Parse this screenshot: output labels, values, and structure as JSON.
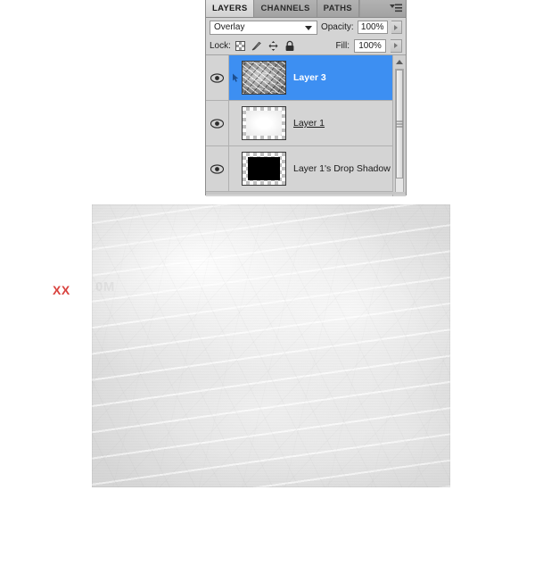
{
  "panel": {
    "tabs": [
      {
        "label": "LAYERS",
        "active": true
      },
      {
        "label": "CHANNELS",
        "active": false
      },
      {
        "label": "PATHS",
        "active": false
      }
    ],
    "menu_icon": "panel-menu-icon",
    "blend_mode": {
      "value": "Overlay",
      "caret_icon": "chevron-down-icon"
    },
    "opacity": {
      "label": "Opacity:",
      "value": "100%",
      "stepper_icon": "chevron-right-icon"
    },
    "fill": {
      "label": "Fill:",
      "value": "100%",
      "stepper_icon": "chevron-right-icon"
    },
    "lock": {
      "label": "Lock:",
      "icons": [
        {
          "name": "lock-transparent-pixels-icon"
        },
        {
          "name": "lock-image-pixels-brush-icon"
        },
        {
          "name": "lock-position-move-icon"
        },
        {
          "name": "lock-all-padlock-icon"
        }
      ]
    },
    "layers": [
      {
        "name": "Layer 3",
        "visible": true,
        "selected": true,
        "underlined": false,
        "thumbnail": "crumpled-grayscale-thumbnail",
        "has_link_marker": true
      },
      {
        "name": "Layer 1",
        "visible": true,
        "selected": false,
        "underlined": true,
        "thumbnail": "white-glow-transparent-thumbnail",
        "has_link_marker": false
      },
      {
        "name": "Layer 1's Drop Shadow",
        "visible": true,
        "selected": false,
        "underlined": false,
        "thumbnail": "black-rectangle-transparent-thumbnail",
        "has_link_marker": false
      }
    ],
    "scrollbar": {
      "up_arrow_icon": "scroll-up-arrow-icon",
      "grip_icon": "scrollbar-grip-icon"
    },
    "colors": {
      "selection_blue": "#3d8ff2",
      "panel_gray": "#d4d4d4",
      "tab_active": "#e3e3e3"
    }
  },
  "canvas": {
    "image_alt": "crumpled-white-paper-texture",
    "watermark": "0M"
  },
  "annotation": {
    "text": "XX",
    "color": "#d9433f"
  }
}
